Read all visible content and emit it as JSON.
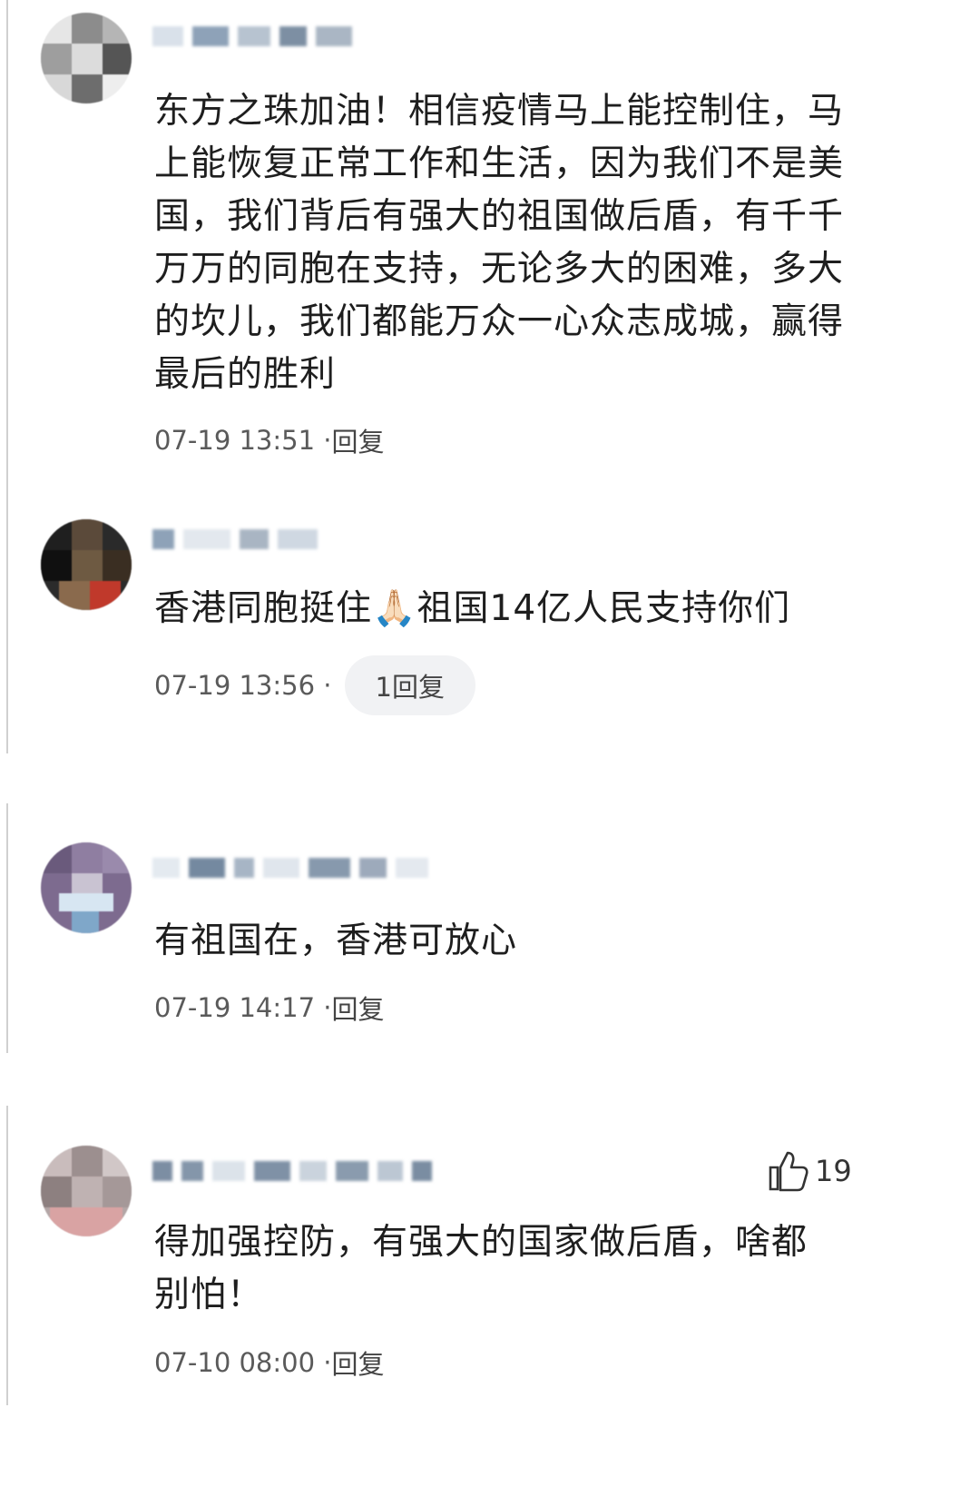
{
  "comments": [
    {
      "text": "东方之珠加油！相信疫情马上能控制住，马上能恢复正常工作和生活，因为我们不是美国，我们背后有强大的祖国做后盾，有千千万万的同胞在支持，无论多大的困难，多大的坎儿，我们都能万众一心众志成城，赢得最后的胜利",
      "time": "07-19 13:51 · ",
      "reply_label": "回复"
    },
    {
      "text": "香港同胞挺住🙏🏻祖国14亿人民支持你们",
      "time": "07-19 13:56 · ",
      "reply_label": "1回复"
    },
    {
      "text": "有祖国在，香港可放心",
      "time": "07-19 14:17 · ",
      "reply_label": "回复"
    },
    {
      "text": "得加强控防，有强大的国家做后盾，啥都别怕！",
      "time": "07-10 08:00 · ",
      "reply_label": "回复",
      "likes": "19"
    }
  ],
  "icons": {
    "like": "thumbs-up-icon"
  }
}
